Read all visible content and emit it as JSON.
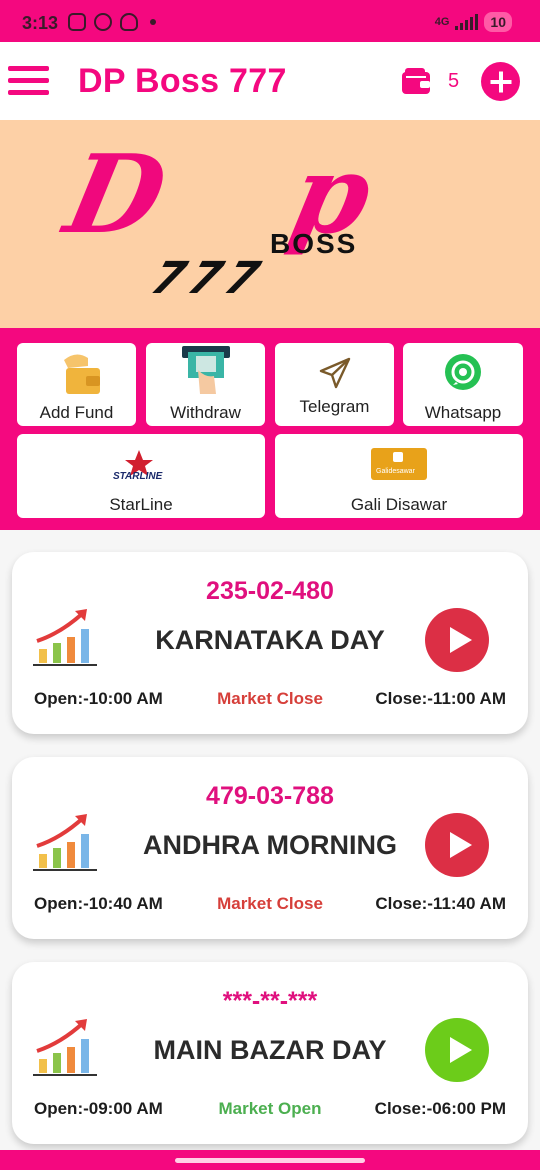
{
  "status_bar": {
    "time": "3:13",
    "network": "4G",
    "battery": "10"
  },
  "header": {
    "title": "DP Boss 777",
    "wallet_count": "5"
  },
  "banner": {
    "logo_main": "Dp",
    "logo_sub": "BOSS",
    "logo_num": "777"
  },
  "actions": {
    "add_fund": "Add Fund",
    "withdraw": "Withdraw",
    "telegram": "Telegram",
    "whatsapp": "Whatsapp",
    "starline": "StarLine",
    "starline_logo_text": "STARLINE",
    "gali_disawar": "Gali Disawar",
    "gali_logo_text": "Galidesawar"
  },
  "markets": [
    {
      "result": "235-02-480",
      "name": "KARNATAKA DAY",
      "open": "Open:-10:00 AM",
      "status": "Market Close",
      "close": "Close:-11:00 AM",
      "status_color": "#d63f3a",
      "play_color": "#dc2f45"
    },
    {
      "result": "479-03-788",
      "name": "ANDHRA MORNING",
      "open": "Open:-10:40 AM",
      "status": "Market Close",
      "close": "Close:-11:40 AM",
      "status_color": "#d63f3a",
      "play_color": "#dc2f45"
    },
    {
      "result": "***-**-***",
      "name": "MAIN BAZAR DAY",
      "open": "Open:-09:00 AM",
      "status": "Market Open",
      "close": "Close:-06:00 PM",
      "status_color": "#4caf50",
      "play_color": "#6ccc1a"
    }
  ],
  "colors": {
    "accent": "#f4087f",
    "banner_bg": "#fdd0a6"
  },
  "icons": [
    "menu-icon",
    "wallet-icon",
    "add-icon",
    "play-icon",
    "chart-icon",
    "telegram-icon",
    "whatsapp-icon"
  ]
}
